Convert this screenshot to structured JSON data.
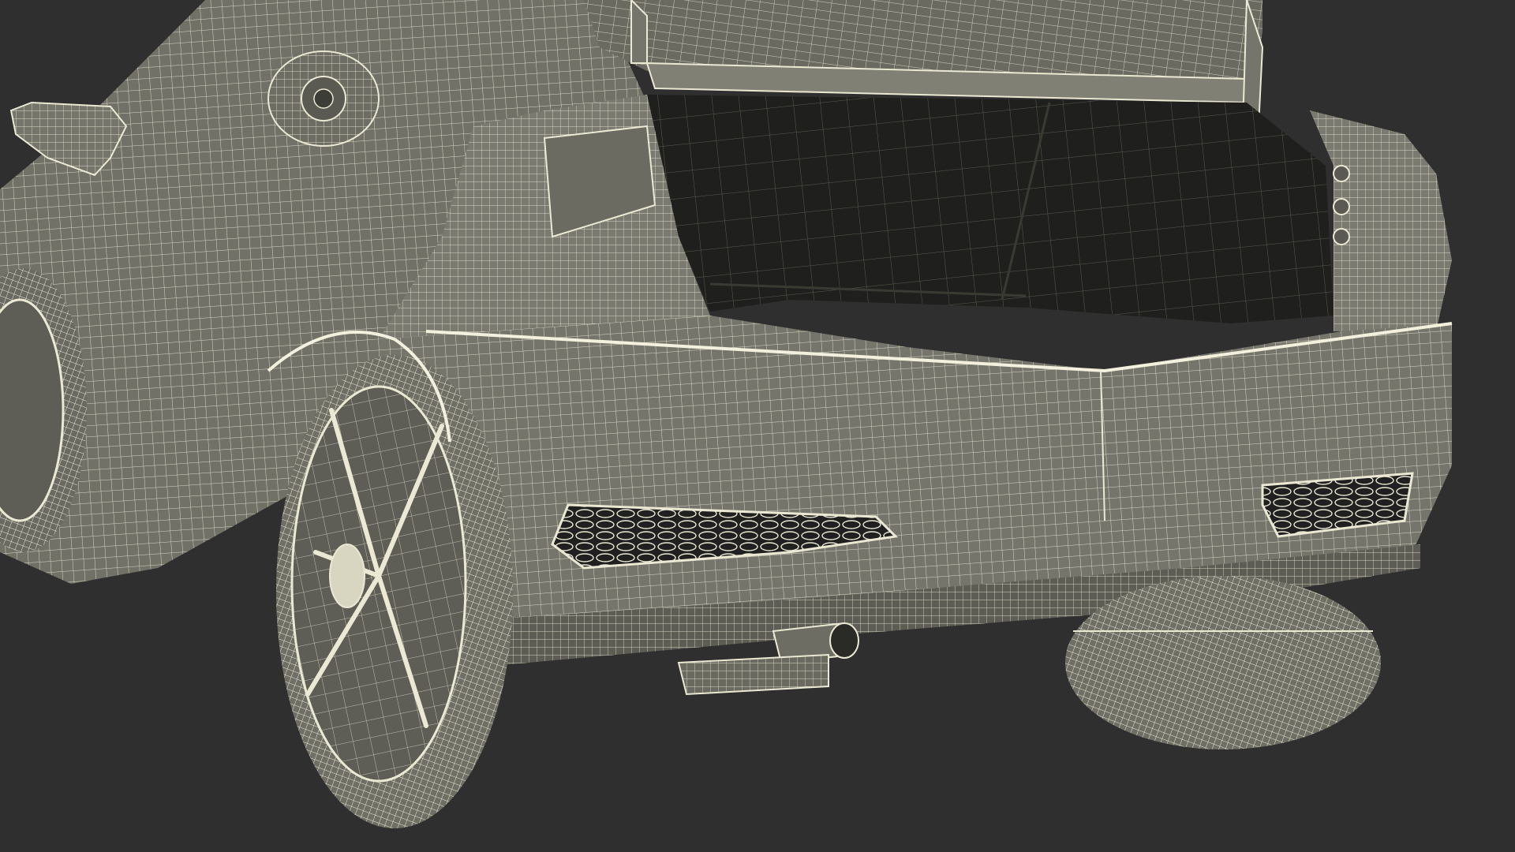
{
  "scene": {
    "subject": "wireframe-car-rear",
    "background_color": "#2f2f2f",
    "body_fill_color": "#77776c",
    "body_dark_fill_color": "#5a5a52",
    "cavity_color": "#1f201d",
    "wire_color": "#e9e6d0",
    "wire_soft_color": "#c9c6b2"
  }
}
